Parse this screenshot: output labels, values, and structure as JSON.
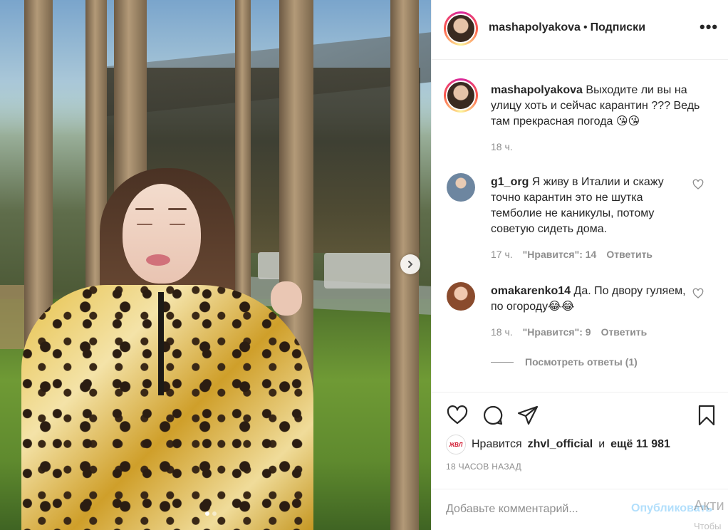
{
  "post": {
    "username": "mashapolyakova",
    "separator": "•",
    "follow_label": "Подписки",
    "more_label": "•••"
  },
  "caption": {
    "username": "mashapolyakova",
    "text": "Выходите ли вы на улицу хоть и сейчас карантин ??? Ведь там прекрасная погода 😘😘",
    "time": "18 ч."
  },
  "comments": [
    {
      "username": "g1_org",
      "text": "Я живу в Италии и скажу точно карантин это не шутка темболие не каникулы, потому советую сидеть дома.",
      "time": "17 ч.",
      "likes": "\"Нравится\": 14",
      "reply": "Ответить"
    },
    {
      "username": "omakarenko14",
      "text": "Да. По двору гуляем, по огороду😂😂",
      "time": "18 ч.",
      "likes": "\"Нравится\": 9",
      "reply": "Ответить"
    }
  ],
  "view_replies": "Посмотреть ответы (1)",
  "likes": {
    "avatar_text": "ЖВЛ",
    "prefix": "Нравится",
    "user": "zhvl_official",
    "middle": "и",
    "count": "ещё 11 981"
  },
  "post_time": "18 ЧАСОВ НАЗАД",
  "add_comment": {
    "placeholder": "Добавьте комментарий...",
    "publish": "Опубликовать"
  },
  "watermark": {
    "line1": "Акти",
    "line2": "Чтобы"
  },
  "icons": {
    "next": "chevron-right-icon",
    "like": "heart-icon",
    "comment": "comment-icon",
    "share": "share-icon",
    "save": "bookmark-icon"
  },
  "colors": {
    "link": "#0095f6",
    "publish_disabled": "#b2dffc",
    "secondary_text": "#8e8e8e"
  }
}
